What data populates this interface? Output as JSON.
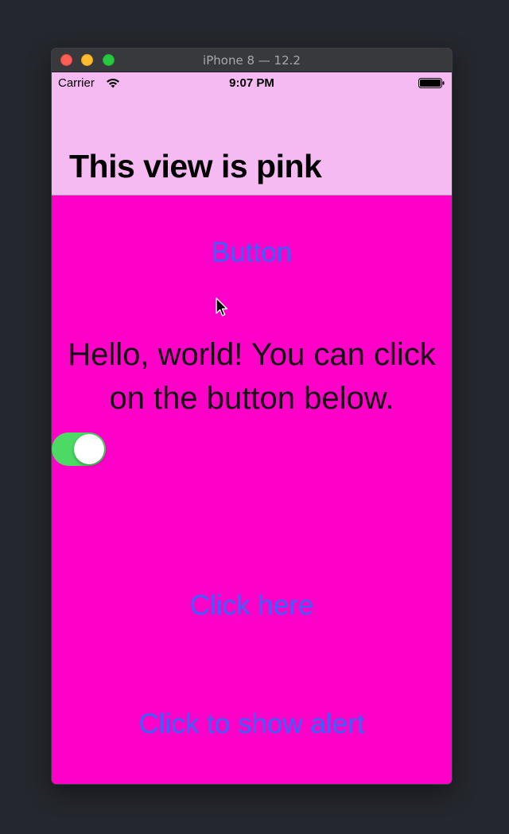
{
  "window": {
    "title": "iPhone 8 — 12.2"
  },
  "status_bar": {
    "carrier": "Carrier",
    "time": "9:07 PM",
    "icons": [
      "wifi-icon",
      "battery-icon"
    ]
  },
  "navigation": {
    "title": "This view is pink"
  },
  "content": {
    "button_label": "Button",
    "hello_text": "Hello, world! You can click on the button below.",
    "switch_on": true,
    "click_here_label": "Click here",
    "show_alert_label": "Click to show alert"
  },
  "colors": {
    "header_background": "#f6baf3",
    "content_background": "#ff00c8",
    "button_text": "#3264ff",
    "switch_on": "#4cd964"
  }
}
